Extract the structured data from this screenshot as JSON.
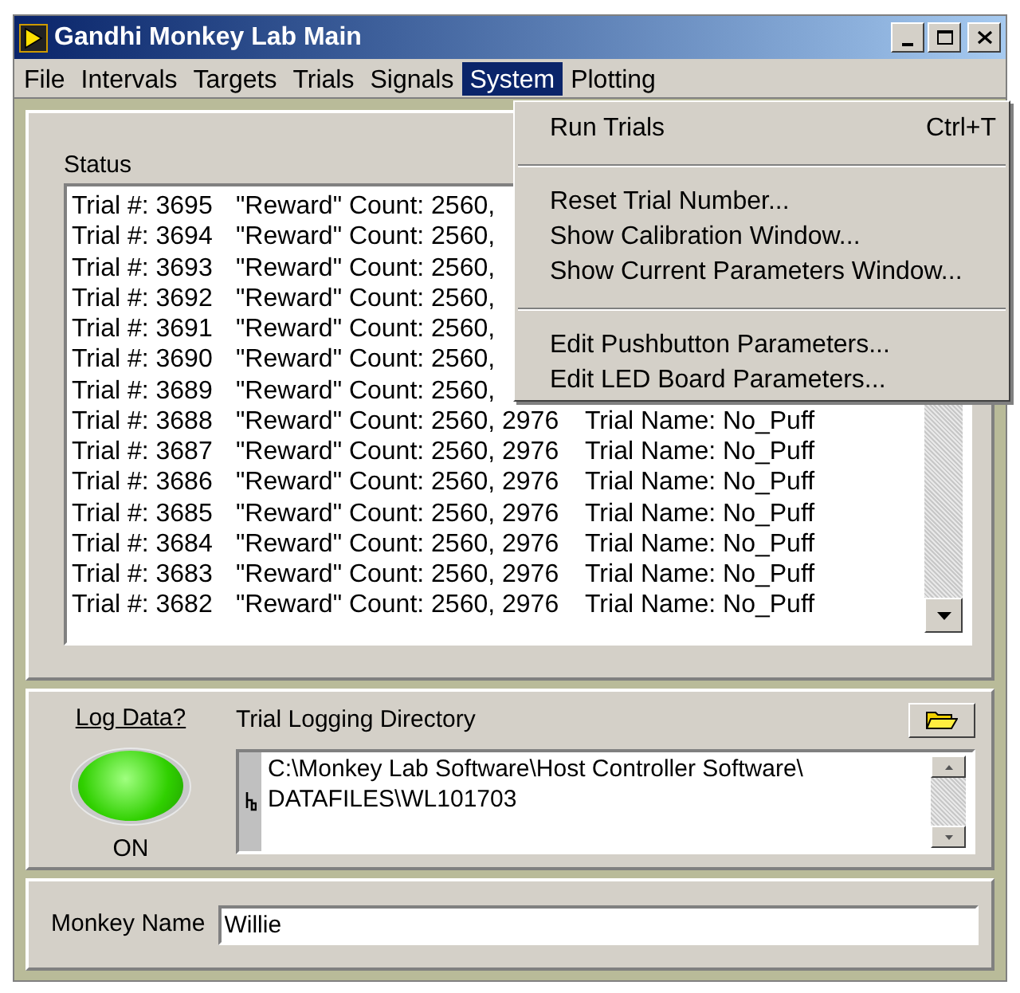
{
  "window": {
    "title": "Gandhi Monkey Lab Main"
  },
  "menu_bar": [
    {
      "label": "File",
      "selected": false
    },
    {
      "label": "Intervals",
      "selected": false
    },
    {
      "label": "Targets",
      "selected": false
    },
    {
      "label": "Trials",
      "selected": false
    },
    {
      "label": "Signals",
      "selected": false
    },
    {
      "label": "System",
      "selected": true
    },
    {
      "label": "Plotting",
      "selected": false
    }
  ],
  "system_menu": [
    {
      "kind": "item",
      "label": "Run Trials",
      "shortcut": "Ctrl+T"
    },
    {
      "kind": "separator"
    },
    {
      "kind": "item",
      "label": "Reset Trial Number..."
    },
    {
      "kind": "item",
      "label": "Show Calibration Window..."
    },
    {
      "kind": "item",
      "label": "Show Current Parameters Window..."
    },
    {
      "kind": "separator"
    },
    {
      "kind": "item",
      "label": "Edit Pushbutton Parameters..."
    },
    {
      "kind": "item",
      "label": "Edit LED Board Parameters..."
    }
  ],
  "status": {
    "label": "Status",
    "rows": [
      {
        "trial": "Trial #: 3695",
        "reward": "\"Reward\" Count: 2560,"
      },
      {
        "trial": "Trial #: 3694",
        "reward": "\"Reward\" Count: 2560,"
      },
      {
        "trial": "Trial #: 3693",
        "reward": "\"Reward\" Count: 2560,"
      },
      {
        "trial": "Trial #: 3692",
        "reward": "\"Reward\" Count: 2560,"
      },
      {
        "trial": "Trial #: 3691",
        "reward": "\"Reward\" Count: 2560,"
      },
      {
        "trial": "Trial #: 3690",
        "reward": "\"Reward\" Count: 2560,"
      },
      {
        "trial": "Trial #: 3689",
        "reward": "\"Reward\" Count: 2560,"
      },
      {
        "trial": "Trial #: 3688",
        "reward": "\"Reward\" Count: 2560, 2976",
        "name": "Trial Name: No_Puff"
      },
      {
        "trial": "Trial #: 3687",
        "reward": "\"Reward\" Count: 2560, 2976",
        "name": "Trial Name: No_Puff"
      },
      {
        "trial": "Trial #: 3686",
        "reward": "\"Reward\" Count: 2560, 2976",
        "name": "Trial Name: No_Puff"
      },
      {
        "trial": "Trial #: 3685",
        "reward": "\"Reward\" Count: 2560, 2976",
        "name": "Trial Name: No_Puff"
      },
      {
        "trial": "Trial #: 3684",
        "reward": "\"Reward\" Count: 2560, 2976",
        "name": "Trial Name: No_Puff"
      },
      {
        "trial": "Trial #: 3683",
        "reward": "\"Reward\" Count: 2560, 2976",
        "name": "Trial Name: No_Puff"
      },
      {
        "trial": "Trial #: 3682",
        "reward": "\"Reward\" Count: 2560, 2976",
        "name": "Trial Name: No_Puff"
      }
    ]
  },
  "log_data": {
    "label": "Log Data?",
    "on": true,
    "state_text": "ON"
  },
  "logging_directory": {
    "label": "Trial Logging Directory",
    "lines": [
      "C:\\Monkey Lab Software\\Host Controller Software\\",
      "DATAFILES\\WL101703"
    ]
  },
  "monkey_name": {
    "label": "Monkey Name",
    "value": "Willie"
  }
}
